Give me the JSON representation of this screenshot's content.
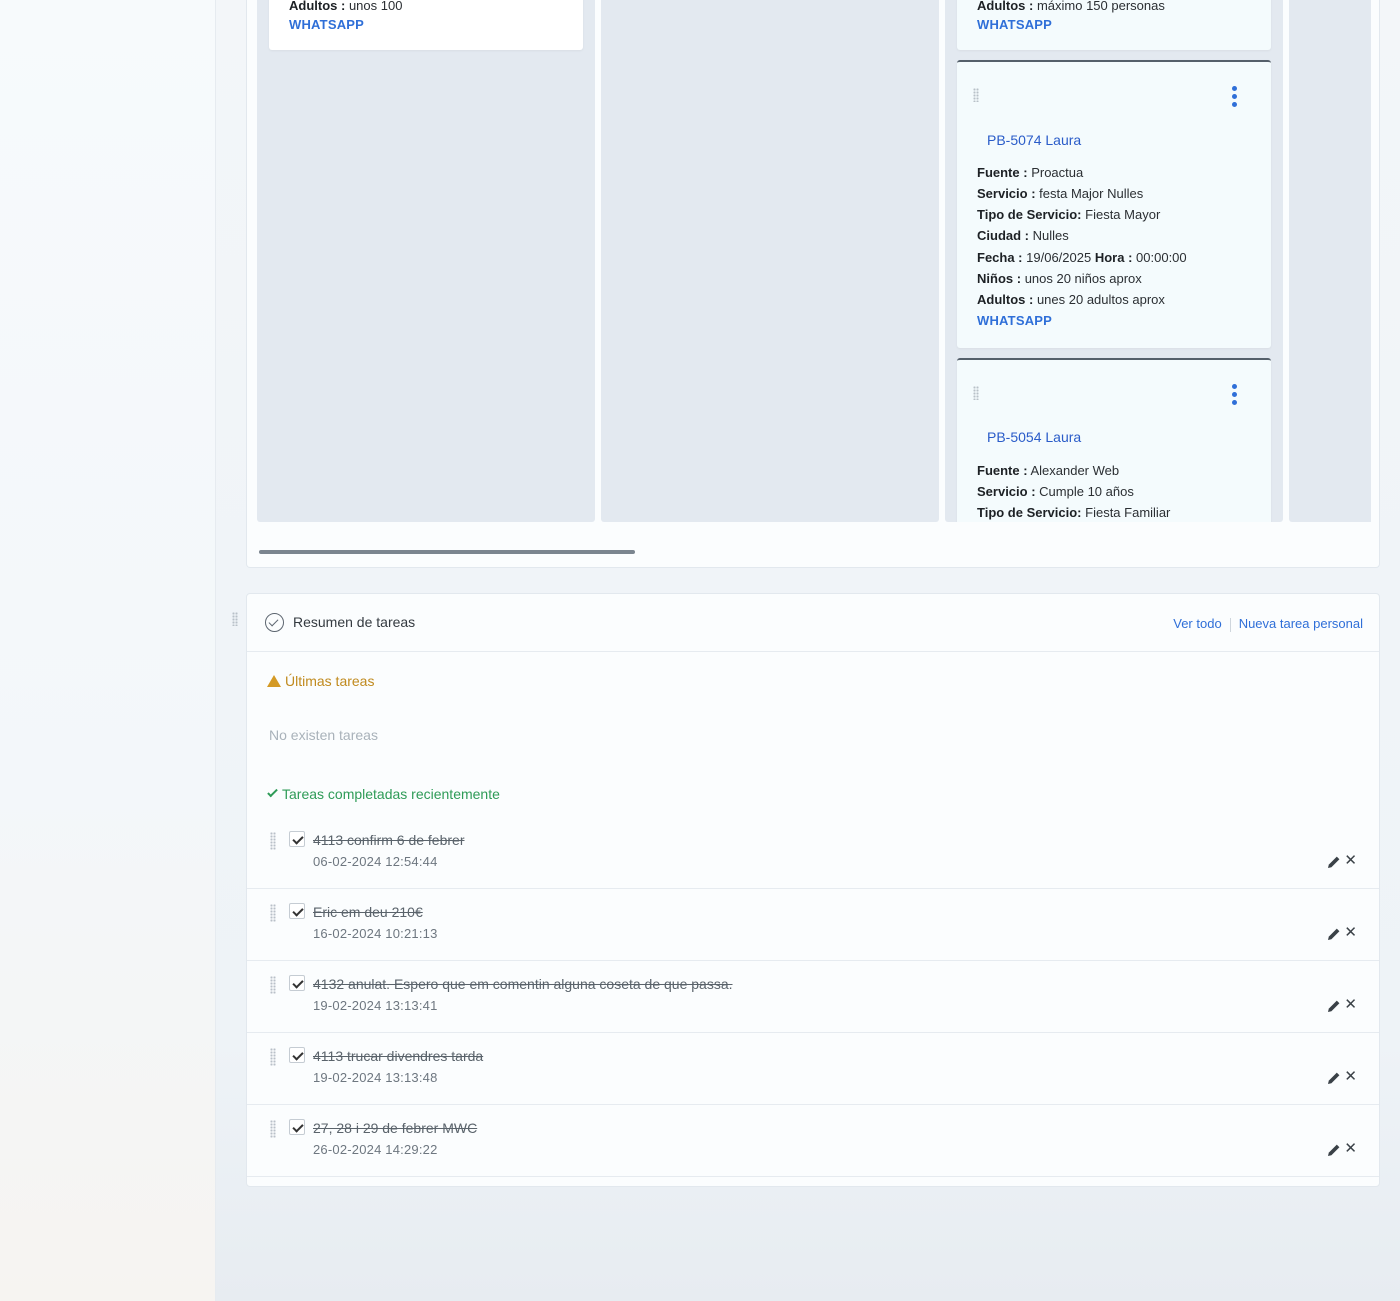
{
  "kanban": {
    "col1_card": {
      "adultos_label": "Adultos :",
      "adultos_value": "unos 100",
      "whatsapp": "WHATSAPP"
    },
    "col3_partial": {
      "adultos_label": "Adultos :",
      "adultos_value": "máximo 150 personas",
      "whatsapp": "WHATSAPP"
    },
    "col3_card1": {
      "title": "PB-5074 Laura",
      "fuente_label": "Fuente :",
      "fuente": "Proactua",
      "servicio_label": "Servicio :",
      "servicio": "festa Major Nulles",
      "tipo_label": "Tipo de Servicio:",
      "tipo": "Fiesta Mayor",
      "ciudad_label": "Ciudad :",
      "ciudad": "Nulles",
      "fecha_label": "Fecha :",
      "fecha": "19/06/2025",
      "hora_label": "Hora :",
      "hora": "00:00:00",
      "ninos_label": "Niños :",
      "ninos": "unos 20 niños aprox",
      "adultos_label": "Adultos :",
      "adultos": "unes 20 adultos aprox",
      "whatsapp": "WHATSAPP"
    },
    "col3_card2": {
      "title": "PB-5054 Laura",
      "fuente_label": "Fuente :",
      "fuente": "Alexander Web",
      "servicio_label": "Servicio :",
      "servicio": "Cumple 10 años",
      "tipo_label": "Tipo de Servicio:",
      "tipo": "Fiesta Familiar"
    },
    "kebab_icon": "more-vertical",
    "drag_icon": "drag-handle"
  },
  "tasks": {
    "title": "Resumen de tareas",
    "ver_todo": "Ver todo",
    "nueva": "Nueva tarea personal",
    "ultimas": "Últimas tareas",
    "empty": "No existen tareas",
    "completadas": "Tareas completadas recientemente",
    "items": [
      {
        "text": "4113 confirm 6 de febrer",
        "date": "06-02-2024 12:54:44"
      },
      {
        "text": "Eric em deu 210€",
        "date": "16-02-2024 10:21:13"
      },
      {
        "text": "4132 anulat. Espero que em comentin alguna coseta de que passa.",
        "date": "19-02-2024 13:13:41"
      },
      {
        "text": "4113 trucar divendres tarda",
        "date": "19-02-2024 13:13:48"
      },
      {
        "text": "27, 28 i 29 de febrer MWC",
        "date": "26-02-2024 14:29:22"
      }
    ],
    "icons": {
      "header": "check-circle",
      "warning": "warning-triangle",
      "done": "checkmark",
      "edit": "pencil",
      "delete": "close-x"
    },
    "colors": {
      "link": "#2f6fd8",
      "warning": "#c08a1e",
      "success": "#2e9b57"
    },
    "delete_glyph": "✕"
  }
}
